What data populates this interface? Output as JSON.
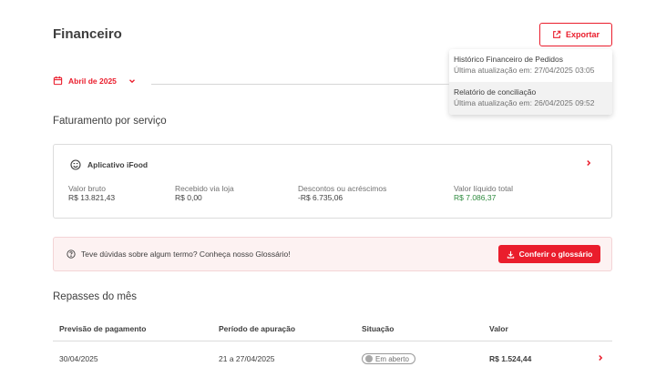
{
  "header": {
    "title": "Financeiro",
    "export_label": "Exportar"
  },
  "export_menu": {
    "items": [
      {
        "title": "Histórico Financeiro de Pedidos",
        "subtitle": "Última atualização em: 27/04/2025 03:05"
      },
      {
        "title": "Relatório de conciliação",
        "subtitle": "Última atualização em: 26/04/2025 09:52"
      }
    ]
  },
  "period": {
    "selected": "Abril de 2025"
  },
  "billing": {
    "title": "Faturamento por serviço",
    "service_name": "Aplicativo iFood",
    "metrics": [
      {
        "label": "Valor bruto",
        "value": "R$ 13.821,43"
      },
      {
        "label": "Recebido via loja",
        "value": "R$ 0,00"
      },
      {
        "label": "Descontos ou acréscimos",
        "value": "-R$ 6.735,06"
      },
      {
        "label": "Valor líquido total",
        "value": "R$ 7.086,37"
      }
    ]
  },
  "glossary": {
    "text": "Teve dúvidas sobre algum termo? Conheça nosso Glossário!",
    "button_label": "Conferir o glossário"
  },
  "transfers": {
    "title": "Repasses do mês",
    "columns": [
      "Previsão de pagamento",
      "Período de apuração",
      "Situação",
      "Valor"
    ],
    "rows": [
      {
        "date": "30/04/2025",
        "period": "21 a 27/04/2025",
        "status": "Em aberto",
        "value": "R$ 1.524,44"
      }
    ]
  },
  "colors": {
    "accent": "#ea1d2c",
    "positive": "#2e8a3e",
    "text": "#3e3e3e",
    "muted": "#717171"
  },
  "icons": {
    "export": "external-link-icon",
    "calendar": "calendar-icon",
    "chevron_down": "chevron-down-icon",
    "chevron_right": "chevron-right-icon",
    "service": "ifood-face-icon",
    "help": "help-circle-icon",
    "download": "download-icon"
  }
}
